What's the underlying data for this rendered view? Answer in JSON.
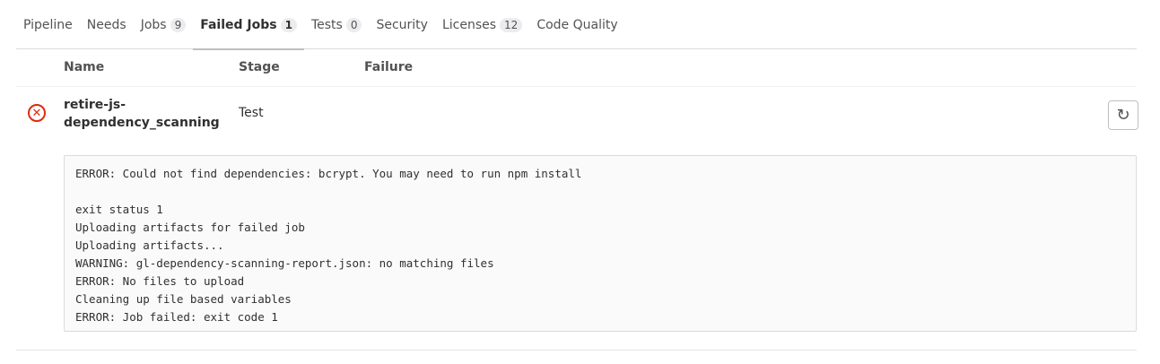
{
  "tabs": [
    {
      "label": "Pipeline"
    },
    {
      "label": "Needs"
    },
    {
      "label": "Jobs",
      "count": "9"
    },
    {
      "label": "Failed Jobs",
      "count": "1",
      "active": true
    },
    {
      "label": "Tests",
      "count": "0"
    },
    {
      "label": "Security"
    },
    {
      "label": "Licenses",
      "count": "12"
    },
    {
      "label": "Code Quality"
    }
  ],
  "table": {
    "headers": {
      "name": "Name",
      "stage": "Stage",
      "failure": "Failure"
    },
    "jobs": [
      {
        "name": "retire-js-dependency_scanning",
        "stage": "Test",
        "status": "failed",
        "log": [
          "ERROR: Could not find dependencies: bcrypt. You may need to run npm install",
          "",
          "exit status 1",
          "Uploading artifacts for failed job",
          "Uploading artifacts...",
          "WARNING: gl-dependency-scanning-report.json: no matching files",
          "ERROR: No files to upload",
          "Cleaning up file based variables",
          "ERROR: Job failed: exit code 1"
        ]
      }
    ]
  },
  "colors": {
    "failed": "#dd2b0e"
  }
}
